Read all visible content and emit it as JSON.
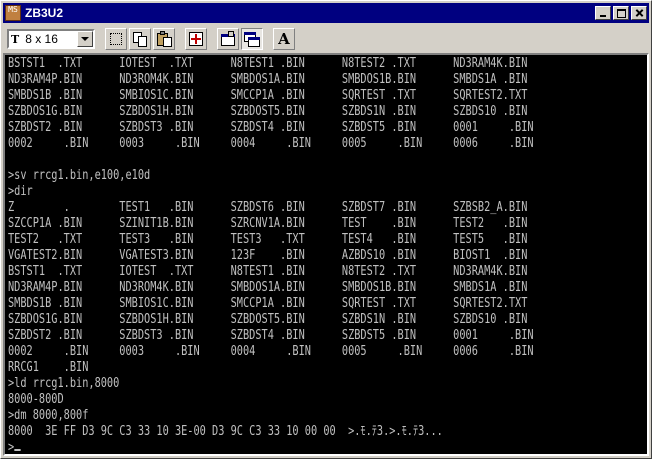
{
  "window": {
    "title": "ZB3U2",
    "app_icon_text": "MS"
  },
  "toolbar": {
    "font_size_label": "8 x 16",
    "font_type_glyph": "T",
    "font_button_glyph": "A",
    "buttons": [
      {
        "name": "mark-icon",
        "pressed": false
      },
      {
        "name": "copy-icon",
        "pressed": false
      },
      {
        "name": "paste-icon",
        "pressed": false
      },
      {
        "name": "fullscreen-icon",
        "pressed": false
      },
      {
        "name": "properties-icon",
        "pressed": false
      },
      {
        "name": "background-icon",
        "pressed": true
      },
      {
        "name": "font-icon",
        "pressed": false
      }
    ]
  },
  "console": {
    "text_color": "#c0c0c0",
    "background": "#000000",
    "lines": [
      "BSTST1  .TXT      IOTEST  .TXT      N8TEST1 .BIN      N8TEST2 .TXT      ND3RAM4K.BIN",
      "ND3RAM4P.BIN      ND3ROM4K.BIN      SMBDOS1A.BIN      SMBDOS1B.BIN      SMBDS1A .BIN",
      "SMBDS1B .BIN      SMBIOS1C.BIN      SMCCP1A .BIN      SQRTEST .TXT      SQRTEST2.TXT",
      "SZBDOS1G.BIN      SZBDOS1H.BIN      SZBDOST5.BIN      SZBDS1N .BIN      SZBDS10 .BIN",
      "SZBDST2 .BIN      SZBDST3 .BIN      SZBDST4 .BIN      SZBDST5 .BIN      0001     .BIN",
      "0002     .BIN     0003     .BIN     0004     .BIN     0005     .BIN     0006     .BIN",
      "",
      ">sv rrcg1.bin,e100,e10d",
      ">dir",
      "Z        .        TEST1   .BIN      SZBDST6 .BIN      SZBDST7 .BIN      SZBSB2_A.BIN",
      "SZCCP1A .BIN      SZINIT1B.BIN      SZRCNV1A.BIN      TEST    .BIN      TEST2   .BIN",
      "TEST2   .TXT      TEST3   .BIN      TEST3   .TXT      TEST4   .BIN      TEST5   .BIN",
      "VGATEST2.BIN      VGATEST3.BIN      123F    .BIN      AZBDS10 .BIN      BIOST1  .BIN",
      "BSTST1  .TXT      IOTEST  .TXT      N8TEST1 .BIN      N8TEST2 .TXT      ND3RAM4K.BIN",
      "ND3RAM4P.BIN      ND3ROM4K.BIN      SMBDOS1A.BIN      SMBDOS1B.BIN      SMBDS1A .BIN",
      "SMBDS1B .BIN      SMBIOS1C.BIN      SMCCP1A .BIN      SQRTEST .TXT      SQRTEST2.TXT",
      "SZBDOS1G.BIN      SZBDOS1H.BIN      SZBDOST5.BIN      SZBDS1N .BIN      SZBDS10 .BIN",
      "SZBDST2 .BIN      SZBDST3 .BIN      SZBDST4 .BIN      SZBDST5 .BIN      0001     .BIN",
      "0002     .BIN     0003     .BIN     0004     .BIN     0005     .BIN     0006     .BIN",
      "RRCG1    .BIN",
      ">ld rrcg1.bin,8000",
      "8000-800D",
      ">dm 8000,800f",
      "8000  3E FF D3 9C C3 33 10 3E-00 D3 9C C3 33 10 00 00  >.ﾓ.ﾃ3.>.ﾓ.ﾃ3...",
      ">"
    ]
  }
}
